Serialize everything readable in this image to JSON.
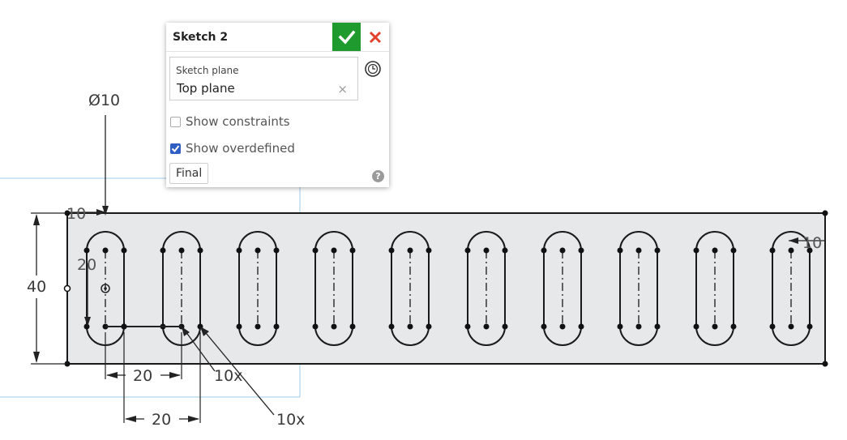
{
  "dialog": {
    "title": "Sketch 2",
    "sketch_plane_label": "Sketch plane",
    "sketch_plane_value": "Top plane",
    "clear_symbol": "×",
    "show_constraints_label": "Show constraints",
    "show_constraints_checked": false,
    "show_overdefined_label": "Show overdefined",
    "show_overdefined_checked": true,
    "final_label": "Final",
    "help_symbol": "?",
    "ok_icon": "checkmark-icon",
    "cancel_icon": "close-icon",
    "history_icon": "clock-icon"
  },
  "dimensions": {
    "diameter": "Ø10",
    "width": "40",
    "left_offset": "10",
    "right_offset": "10",
    "slot_height": "20",
    "pitch_a": "20",
    "pitch_b": "20",
    "pattern_count_a": "10x",
    "pattern_count_b": "10x"
  },
  "slot_count": 10,
  "colors": {
    "ok_green": "#1e9a2f",
    "cancel_red": "#e2402a",
    "plate_fill": "#e6e8ea",
    "plane_outline": "#9ccbe8",
    "checkbox_blue": "#2f5ec4"
  }
}
